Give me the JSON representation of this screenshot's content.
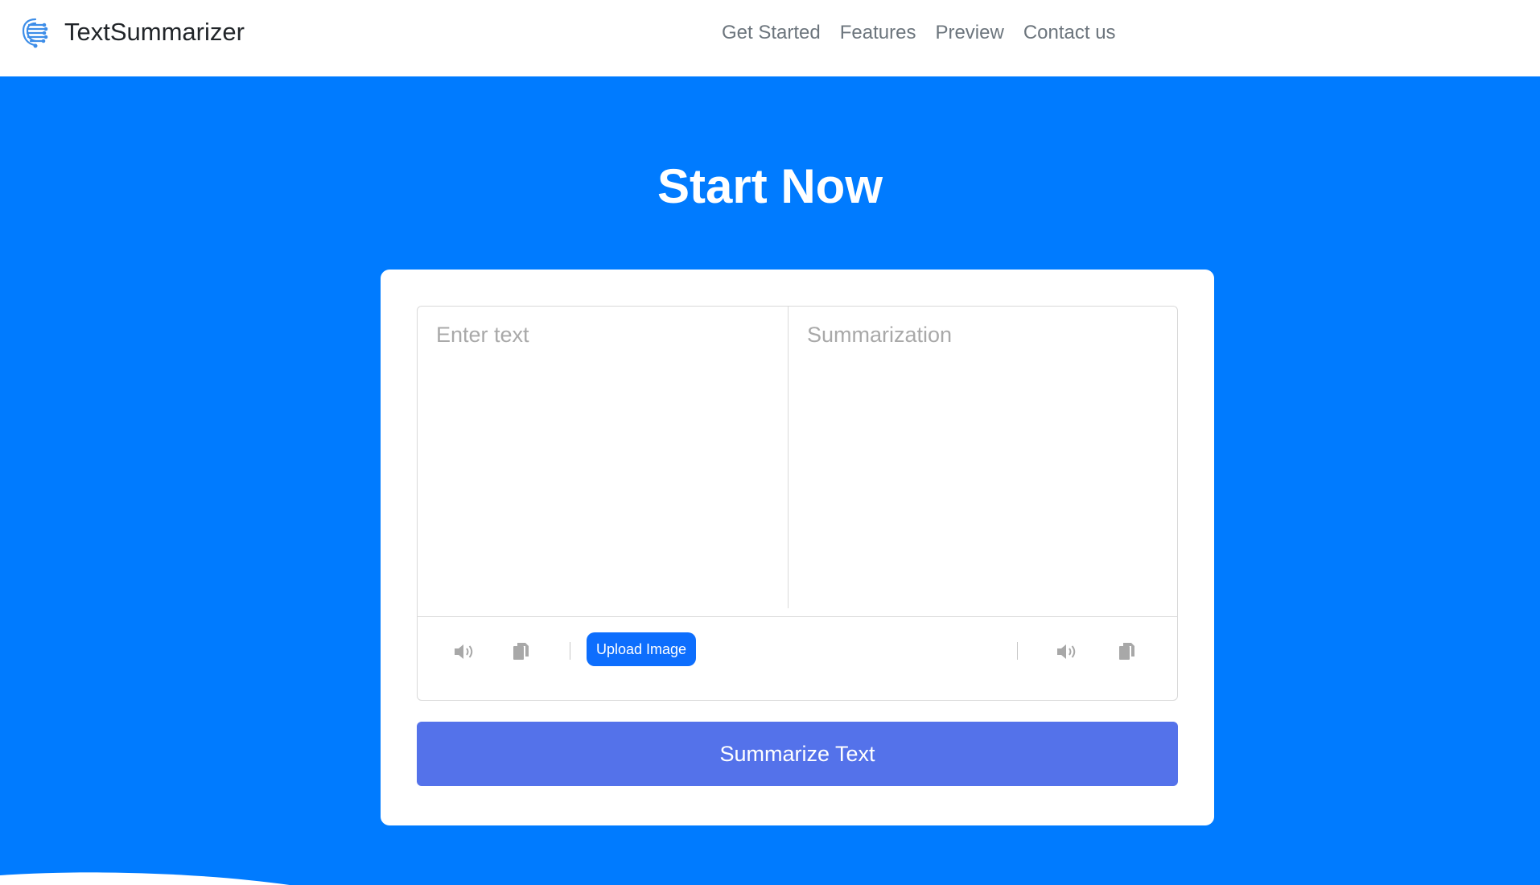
{
  "brand": {
    "name": "TextSummarizer",
    "logo_icon": "circuit-brain-icon"
  },
  "nav": {
    "items": [
      "Get Started",
      "Features",
      "Preview",
      "Contact us"
    ]
  },
  "hero": {
    "title": "Start Now"
  },
  "editor": {
    "input_placeholder": "Enter text",
    "output_placeholder": "Summarization",
    "input_value": "",
    "output_value": ""
  },
  "toolbar": {
    "left": {
      "speak_icon": "volume-icon",
      "copy_icon": "copy-icon"
    },
    "upload_label": "Upload Image",
    "right": {
      "speak_icon": "volume-icon",
      "copy_icon": "copy-icon"
    }
  },
  "actions": {
    "summarize_label": "Summarize Text"
  },
  "colors": {
    "primary": "#007bff",
    "upload_button": "#0d6efd",
    "summarize_button": "#5472ea",
    "icon_gray": "#a8a8a8"
  }
}
